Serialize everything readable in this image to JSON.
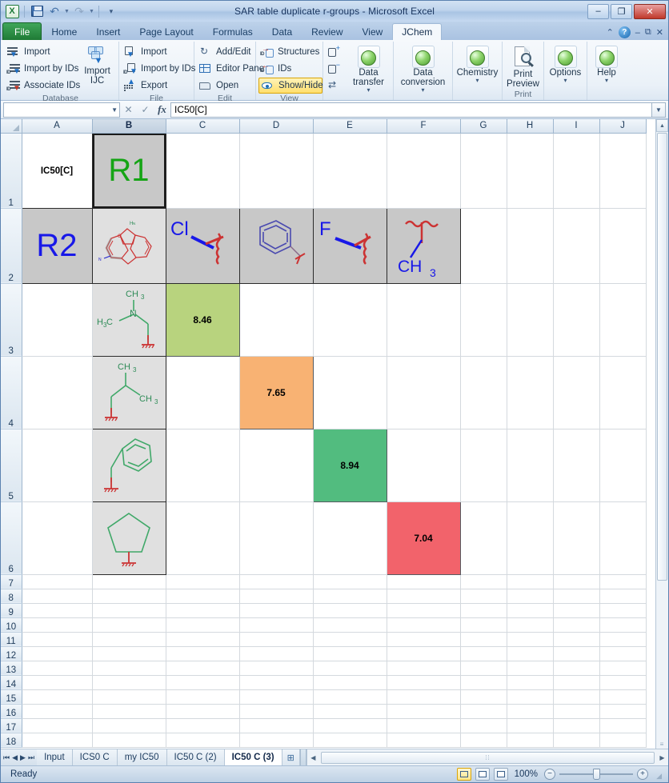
{
  "window": {
    "title": "SAR table duplicate r-groups  -  Microsoft Excel",
    "app_logo": "excel-logo",
    "quick_access": [
      {
        "name": "save-icon",
        "label": "Save"
      },
      {
        "name": "undo-icon",
        "label": "Undo"
      },
      {
        "name": "redo-icon",
        "label": "Redo"
      },
      {
        "name": "customize-qat-icon",
        "label": "Customize Quick Access Toolbar"
      }
    ],
    "controls": {
      "minimize": "–",
      "restore": "❐",
      "close": "✕"
    }
  },
  "ribbon": {
    "tabs": [
      {
        "label": "File",
        "active": false,
        "kind": "file"
      },
      {
        "label": "Home",
        "active": false
      },
      {
        "label": "Insert",
        "active": false
      },
      {
        "label": "Page Layout",
        "active": false
      },
      {
        "label": "Formulas",
        "active": false
      },
      {
        "label": "Data",
        "active": false
      },
      {
        "label": "Review",
        "active": false
      },
      {
        "label": "View",
        "active": false
      },
      {
        "label": "JChem",
        "active": true
      }
    ],
    "right_controls": [
      {
        "name": "ribbon-help-icon",
        "label": "?"
      },
      {
        "name": "ribbon-minimize-icon",
        "label": "–"
      },
      {
        "name": "ribbon-restore-icon",
        "label": "❐"
      },
      {
        "name": "ribbon-close-icon",
        "label": "✕"
      }
    ],
    "groups": [
      {
        "name": "database",
        "label": "Database",
        "small_buttons": [
          {
            "label": "Import",
            "icon": "import-icon",
            "highlighted": false
          },
          {
            "label": "Import by IDs",
            "icon": "import-by-ids-icon",
            "highlighted": false
          },
          {
            "label": "Associate IDs",
            "icon": "associate-ids-icon",
            "highlighted": false
          }
        ],
        "big_buttons": [
          {
            "label_line1": "Import",
            "label_line2": "IJC",
            "icon": "import-ijc-icon",
            "dropdown": false
          }
        ]
      },
      {
        "name": "file",
        "label": "File",
        "small_buttons": [
          {
            "label": "Import",
            "icon": "file-import-icon",
            "highlighted": false
          },
          {
            "label": "Import by IDs",
            "icon": "file-import-by-ids-icon",
            "highlighted": false
          },
          {
            "label": "Export",
            "icon": "file-export-icon",
            "highlighted": false
          }
        ],
        "big_buttons": []
      },
      {
        "name": "edit",
        "label": "Edit",
        "small_buttons": [
          {
            "label": "Add/Edit",
            "icon": "add-edit-icon",
            "highlighted": false
          },
          {
            "label": "Editor Pane",
            "icon": "editor-pane-icon",
            "highlighted": false
          },
          {
            "label": "Open",
            "icon": "open-icon",
            "highlighted": false
          }
        ],
        "big_buttons": []
      },
      {
        "name": "view",
        "label": "View",
        "small_buttons": [
          {
            "label": "Structures",
            "icon": "structures-icon",
            "highlighted": false
          },
          {
            "label": "IDs",
            "icon": "ids-icon",
            "highlighted": false
          },
          {
            "label": "Show/Hide",
            "icon": "show-hide-icon",
            "highlighted": true
          }
        ],
        "big_buttons": []
      },
      {
        "name": "structure-tools",
        "label": "",
        "small_buttons": [
          {
            "label": "",
            "icon": "add-structure-icon",
            "highlighted": false
          },
          {
            "label": "",
            "icon": "remove-structure-icon",
            "highlighted": false
          },
          {
            "label": "",
            "icon": "refresh-structure-icon",
            "highlighted": false
          }
        ],
        "big_buttons": []
      },
      {
        "name": "data-transfer",
        "label": "",
        "small_buttons": [],
        "big_buttons": [
          {
            "label_line1": "Data",
            "label_line2": "transfer",
            "icon": "data-transfer-icon",
            "dropdown": true
          }
        ]
      },
      {
        "name": "data-conversion",
        "label": "",
        "small_buttons": [],
        "big_buttons": [
          {
            "label_line1": "Data",
            "label_line2": "conversion",
            "icon": "data-conversion-icon",
            "dropdown": true
          }
        ]
      },
      {
        "name": "chemistry",
        "label": "",
        "small_buttons": [],
        "big_buttons": [
          {
            "label_line1": "Chemistry",
            "label_line2": "",
            "icon": "chemistry-icon",
            "dropdown": true
          }
        ]
      },
      {
        "name": "print",
        "label": "Print",
        "small_buttons": [],
        "big_buttons": [
          {
            "label_line1": "Print",
            "label_line2": "Preview",
            "icon": "print-preview-icon",
            "dropdown": false
          }
        ]
      },
      {
        "name": "options",
        "label": "",
        "small_buttons": [],
        "big_buttons": [
          {
            "label_line1": "Options",
            "label_line2": "",
            "icon": "options-icon",
            "dropdown": true
          }
        ]
      },
      {
        "name": "help",
        "label": "",
        "small_buttons": [],
        "big_buttons": [
          {
            "label_line1": "Help",
            "label_line2": "",
            "icon": "help-icon",
            "dropdown": true
          }
        ]
      }
    ]
  },
  "formula_bar": {
    "name_box_value": "",
    "name_box_placeholder": "",
    "formula_value": "IC50[C]",
    "fx_label": "fx",
    "expand_icon": "chevron-down-icon"
  },
  "grid": {
    "columns": [
      "A",
      "B",
      "C",
      "D",
      "E",
      "F",
      "G",
      "H",
      "I",
      "J"
    ],
    "selected_column": "B",
    "active_cell": "B1",
    "rows": [
      "1",
      "2",
      "3",
      "4",
      "5",
      "6",
      "7",
      "8",
      "9",
      "10",
      "11",
      "12",
      "13",
      "14",
      "15",
      "16",
      "17",
      "18"
    ],
    "cells": {
      "A1": {
        "text": "IC50[C]",
        "style": "whitecell"
      },
      "B1": {
        "text": "R1",
        "style": "hdrcell",
        "color": "#15A415",
        "big": true
      },
      "A2": {
        "text": "R2",
        "style": "hdrcell",
        "color": "#1818E8",
        "big": true
      },
      "B2": {
        "text": "",
        "style": "structcell",
        "structure": "tricyclic-scaffold"
      },
      "C2": {
        "text": "",
        "style": "hdrcell",
        "structure": "chloro-substituent",
        "label": "Cl"
      },
      "D2": {
        "text": "",
        "style": "hdrcell",
        "structure": "phenyl-substituent",
        "label": ""
      },
      "E2": {
        "text": "",
        "style": "hdrcell",
        "structure": "fluoro-substituent",
        "label": "F"
      },
      "F2": {
        "text": "",
        "style": "hdrcell",
        "structure": "methyl-substituent",
        "label": "CH3"
      },
      "B3": {
        "text": "",
        "style": "structcell",
        "structure": "dimethylaminoethyl"
      },
      "B4": {
        "text": "",
        "style": "structcell",
        "structure": "isobutyl"
      },
      "B5": {
        "text": "",
        "style": "structcell",
        "structure": "benzyl"
      },
      "B6": {
        "text": "",
        "style": "structcell",
        "structure": "cyclopentyl"
      },
      "C3": {
        "text": "8.46",
        "style": "datacell",
        "bg": "#b8d37e"
      },
      "D4": {
        "text": "7.65",
        "style": "datacell",
        "bg": "#f8b273"
      },
      "E5": {
        "text": "8.94",
        "style": "datacell",
        "bg": "#52bc7f"
      },
      "F6": {
        "text": "7.04",
        "style": "datacell",
        "bg": "#f2636b"
      }
    },
    "scrollbar": {
      "up_icon": "caret-up-icon",
      "down_icon": "caret-down-icon"
    }
  },
  "sheet_tabs": {
    "nav": [
      {
        "name": "first-sheet-button",
        "glyph": "⏮"
      },
      {
        "name": "prev-sheet-button",
        "glyph": "◀"
      },
      {
        "name": "next-sheet-button",
        "glyph": "▶"
      },
      {
        "name": "last-sheet-button",
        "glyph": "⏭"
      }
    ],
    "tabs": [
      {
        "label": "Input",
        "active": false
      },
      {
        "label": "ICS0 C",
        "active": false
      },
      {
        "label": "my IC50",
        "active": false
      },
      {
        "label": "IC50 C (2)",
        "active": false
      },
      {
        "label": "IC50 C (3)",
        "active": true
      }
    ],
    "new_sheet_icon": "insert-worksheet-icon",
    "hscroll_left_icon": "caret-left-icon",
    "hscroll_right_icon": "caret-right-icon"
  },
  "status_bar": {
    "status_text": "Ready",
    "view_buttons": [
      {
        "name": "normal-view-button",
        "active": true
      },
      {
        "name": "page-layout-view-button",
        "active": false
      },
      {
        "name": "page-break-preview-button",
        "active": false
      }
    ],
    "zoom_level": "100%",
    "zoom_out_glyph": "−",
    "zoom_in_glyph": "+"
  }
}
